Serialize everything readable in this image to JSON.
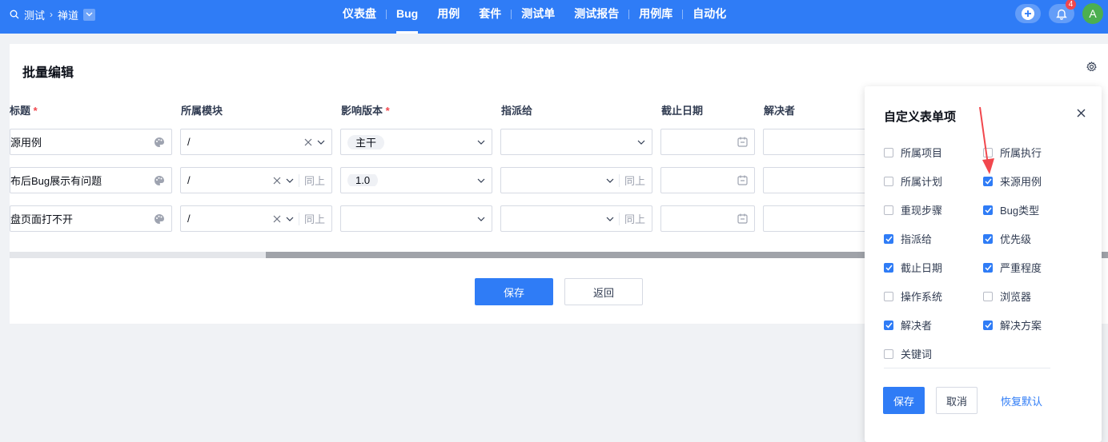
{
  "topbar": {
    "search_label": "测试",
    "product_label": "禅道",
    "nav": [
      "仪表盘",
      "Bug",
      "用例",
      "套件",
      "测试单",
      "测试报告",
      "用例库",
      "自动化"
    ],
    "active_nav": "Bug",
    "notification_count": "4",
    "avatar_letter": "A",
    "color": "#2f7cf6"
  },
  "page": {
    "title": "批量编辑",
    "columns": {
      "title": "标题",
      "module": "所属模块",
      "build": "影响版本",
      "assigned": "指派给",
      "deadline": "截止日期",
      "resolver": "解决者"
    },
    "ditto_label": "同上",
    "rows": [
      {
        "title": "源用例",
        "module": "/",
        "build": "主干"
      },
      {
        "title": "布后Bug展示有问题",
        "module": "/",
        "build": "1.0"
      },
      {
        "title": "盘页面打不开",
        "module": "/",
        "build": ""
      }
    ],
    "save_label": "保存",
    "back_label": "返回"
  },
  "popup": {
    "title": "自定义表单项",
    "options": [
      {
        "label": "所属项目",
        "checked": false
      },
      {
        "label": "所属执行",
        "checked": false
      },
      {
        "label": "所属计划",
        "checked": false
      },
      {
        "label": "来源用例",
        "checked": true
      },
      {
        "label": "重现步骤",
        "checked": false
      },
      {
        "label": "Bug类型",
        "checked": true
      },
      {
        "label": "指派给",
        "checked": true
      },
      {
        "label": "优先级",
        "checked": true
      },
      {
        "label": "截止日期",
        "checked": true
      },
      {
        "label": "严重程度",
        "checked": true
      },
      {
        "label": "操作系统",
        "checked": false
      },
      {
        "label": "浏览器",
        "checked": false
      },
      {
        "label": "解决者",
        "checked": true
      },
      {
        "label": "解决方案",
        "checked": true
      },
      {
        "label": "关键词",
        "checked": false
      }
    ],
    "save_label": "保存",
    "cancel_label": "取消",
    "reset_label": "恢复默认"
  }
}
